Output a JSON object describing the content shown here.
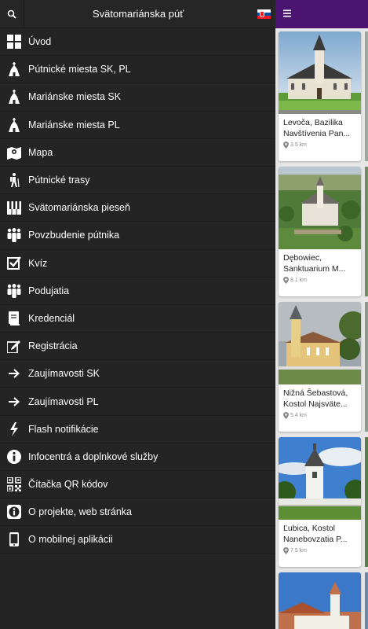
{
  "header": {
    "title": "Svätomariánska púť",
    "search_icon": "search-icon",
    "flag_icon": "slovak-flag-icon"
  },
  "menu": [
    {
      "label": "Úvod",
      "icon": "grid-icon"
    },
    {
      "label": "Pútnické miesta SK, PL",
      "icon": "church-icon"
    },
    {
      "label": "Mariánske miesta SK",
      "icon": "church-icon"
    },
    {
      "label": "Mariánske miesta PL",
      "icon": "church-icon"
    },
    {
      "label": "Mapa",
      "icon": "map-icon"
    },
    {
      "label": "Pútnické trasy",
      "icon": "hiker-icon"
    },
    {
      "label": "Svätomariánska pieseň",
      "icon": "piano-icon"
    },
    {
      "label": "Povzbudenie pútnika",
      "icon": "people-icon"
    },
    {
      "label": "Kvíz",
      "icon": "checkbox-icon"
    },
    {
      "label": "Podujatia",
      "icon": "people-icon"
    },
    {
      "label": "Kredenciál",
      "icon": "book-icon"
    },
    {
      "label": "Registrácia",
      "icon": "edit-icon"
    },
    {
      "label": "Zaujímavosti SK",
      "icon": "arrow-right-icon"
    },
    {
      "label": "Zaujímavosti PL",
      "icon": "arrow-right-icon"
    },
    {
      "label": "Flash notifikácie",
      "icon": "lightning-icon"
    },
    {
      "label": "Infocentrá a doplnkové služby",
      "icon": "info-icon"
    },
    {
      "label": "Čítačka QR kódov",
      "icon": "qr-code-icon"
    },
    {
      "label": "O projekte, web stránka",
      "icon": "info-square-icon"
    },
    {
      "label": "O mobilnej aplikácii",
      "icon": "phone-icon"
    }
  ],
  "panel": {
    "menu_icon": "hamburger-icon",
    "cards": [
      {
        "title_line1": "Levoča, Bazilika",
        "title_line2": "Navštívenia Pan...",
        "distance": "3.5 km"
      },
      {
        "title_line1": "Dębowiec,",
        "title_line2": "Sanktuarium M...",
        "distance": "8.1 km"
      },
      {
        "title_line1": "Nižná Šebastová,",
        "title_line2": "Kostol Najsväte...",
        "distance": "5.4 km"
      },
      {
        "title_line1": "Ľubica, Kostol",
        "title_line2": "Nanebovzatia P...",
        "distance": "7.5 km"
      }
    ]
  },
  "colors": {
    "drawer_bg": "#242424",
    "topbar": "#4a1470",
    "panel_bg": "#e6e6e6"
  }
}
